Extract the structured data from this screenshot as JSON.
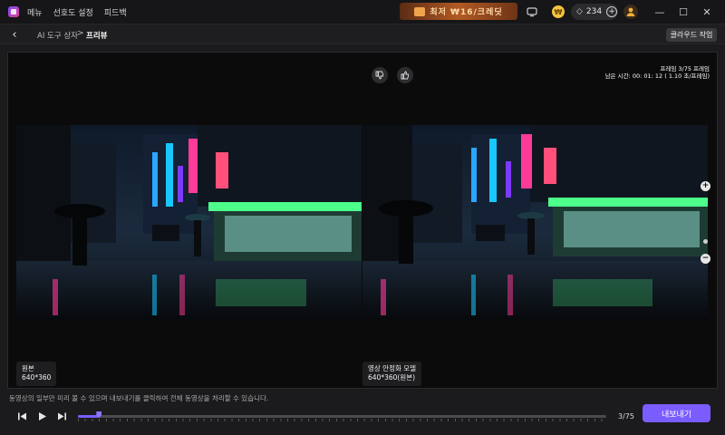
{
  "titlebar": {
    "menu": [
      "메뉴",
      "선호도 설정",
      "피드백"
    ],
    "promo": "최저 ₩16/크레딧",
    "credits": "234"
  },
  "toolbar": {
    "breadcrumb_parent": "AI 도구 상자",
    "breadcrumb_sep": ">",
    "breadcrumb_current": "프리뷰",
    "cloud_button": "클라우드 작업"
  },
  "viewer": {
    "preview_frames": "프레임 3/75 프레임",
    "remaining_time": "남은 시간: 00: 01: 12 ( 1.10 초/프레임)",
    "left_label": {
      "title": "원본",
      "size": "640*360"
    },
    "right_label": {
      "title": "영상 안정화 모델",
      "size": "640*360(원본)"
    }
  },
  "bottom": {
    "notice": "동영상의 일부만 미리 볼 수 있으며 내보내기를 클릭하여 전체 동영상을 처리할 수 있습니다.",
    "frame_count": "3/75",
    "progress_fraction": 0.04,
    "export_button": "내보내기"
  },
  "colors": {
    "accent": "#7b5cff",
    "background": "#1b1b1d"
  }
}
